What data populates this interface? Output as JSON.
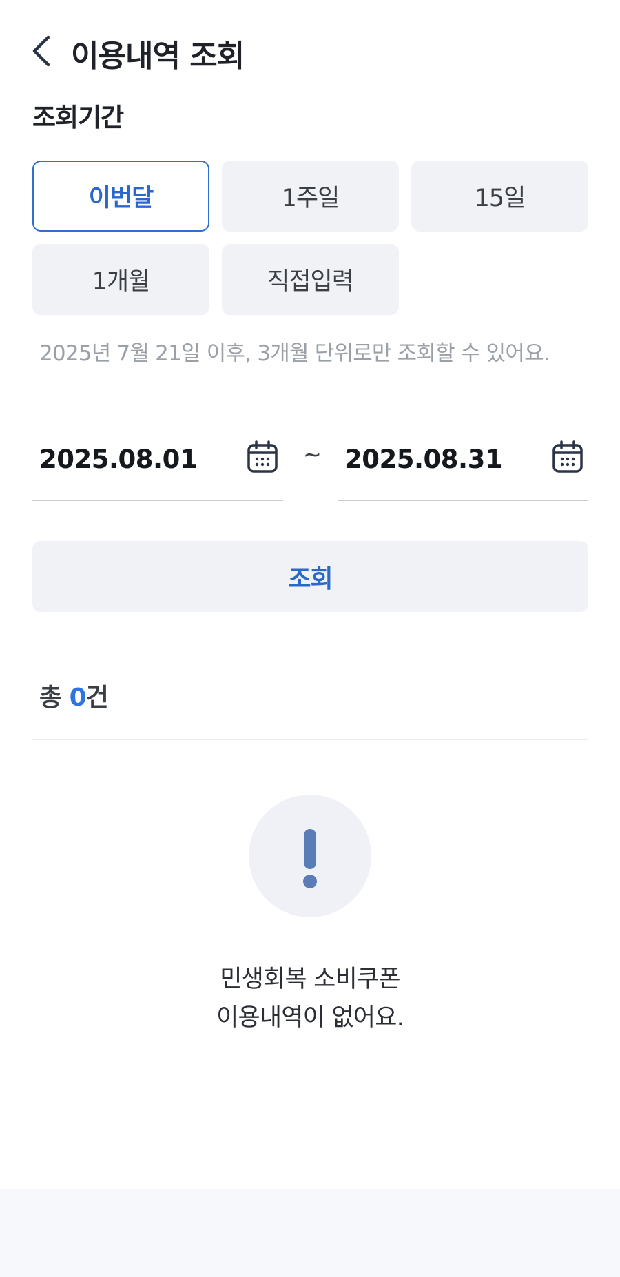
{
  "header": {
    "title": "이용내역 조회",
    "back_icon": "chevron-left-icon"
  },
  "period": {
    "label": "조회기간",
    "options": [
      {
        "label": "이번달",
        "selected": true
      },
      {
        "label": "1주일",
        "selected": false
      },
      {
        "label": "15일",
        "selected": false
      },
      {
        "label": "1개월",
        "selected": false
      },
      {
        "label": "직접입력",
        "selected": false
      }
    ],
    "notice": "2025년 7월 21일 이후, 3개월 단위로만 조회할 수 있어요."
  },
  "date_range": {
    "start": "2025.08.01",
    "separator": "~",
    "end": "2025.08.31",
    "icon": "calendar-icon"
  },
  "search_button": {
    "label": "조회"
  },
  "result": {
    "prefix": "총 ",
    "count": "0",
    "suffix": "건"
  },
  "empty_state": {
    "icon": "exclamation-icon",
    "line1": "민생회복 소비쿠폰",
    "line2": "이용내역이 없어요."
  },
  "colors": {
    "accent": "#2a68cc",
    "chip_bg": "#f1f2f6",
    "icon": "#5a7db8"
  }
}
